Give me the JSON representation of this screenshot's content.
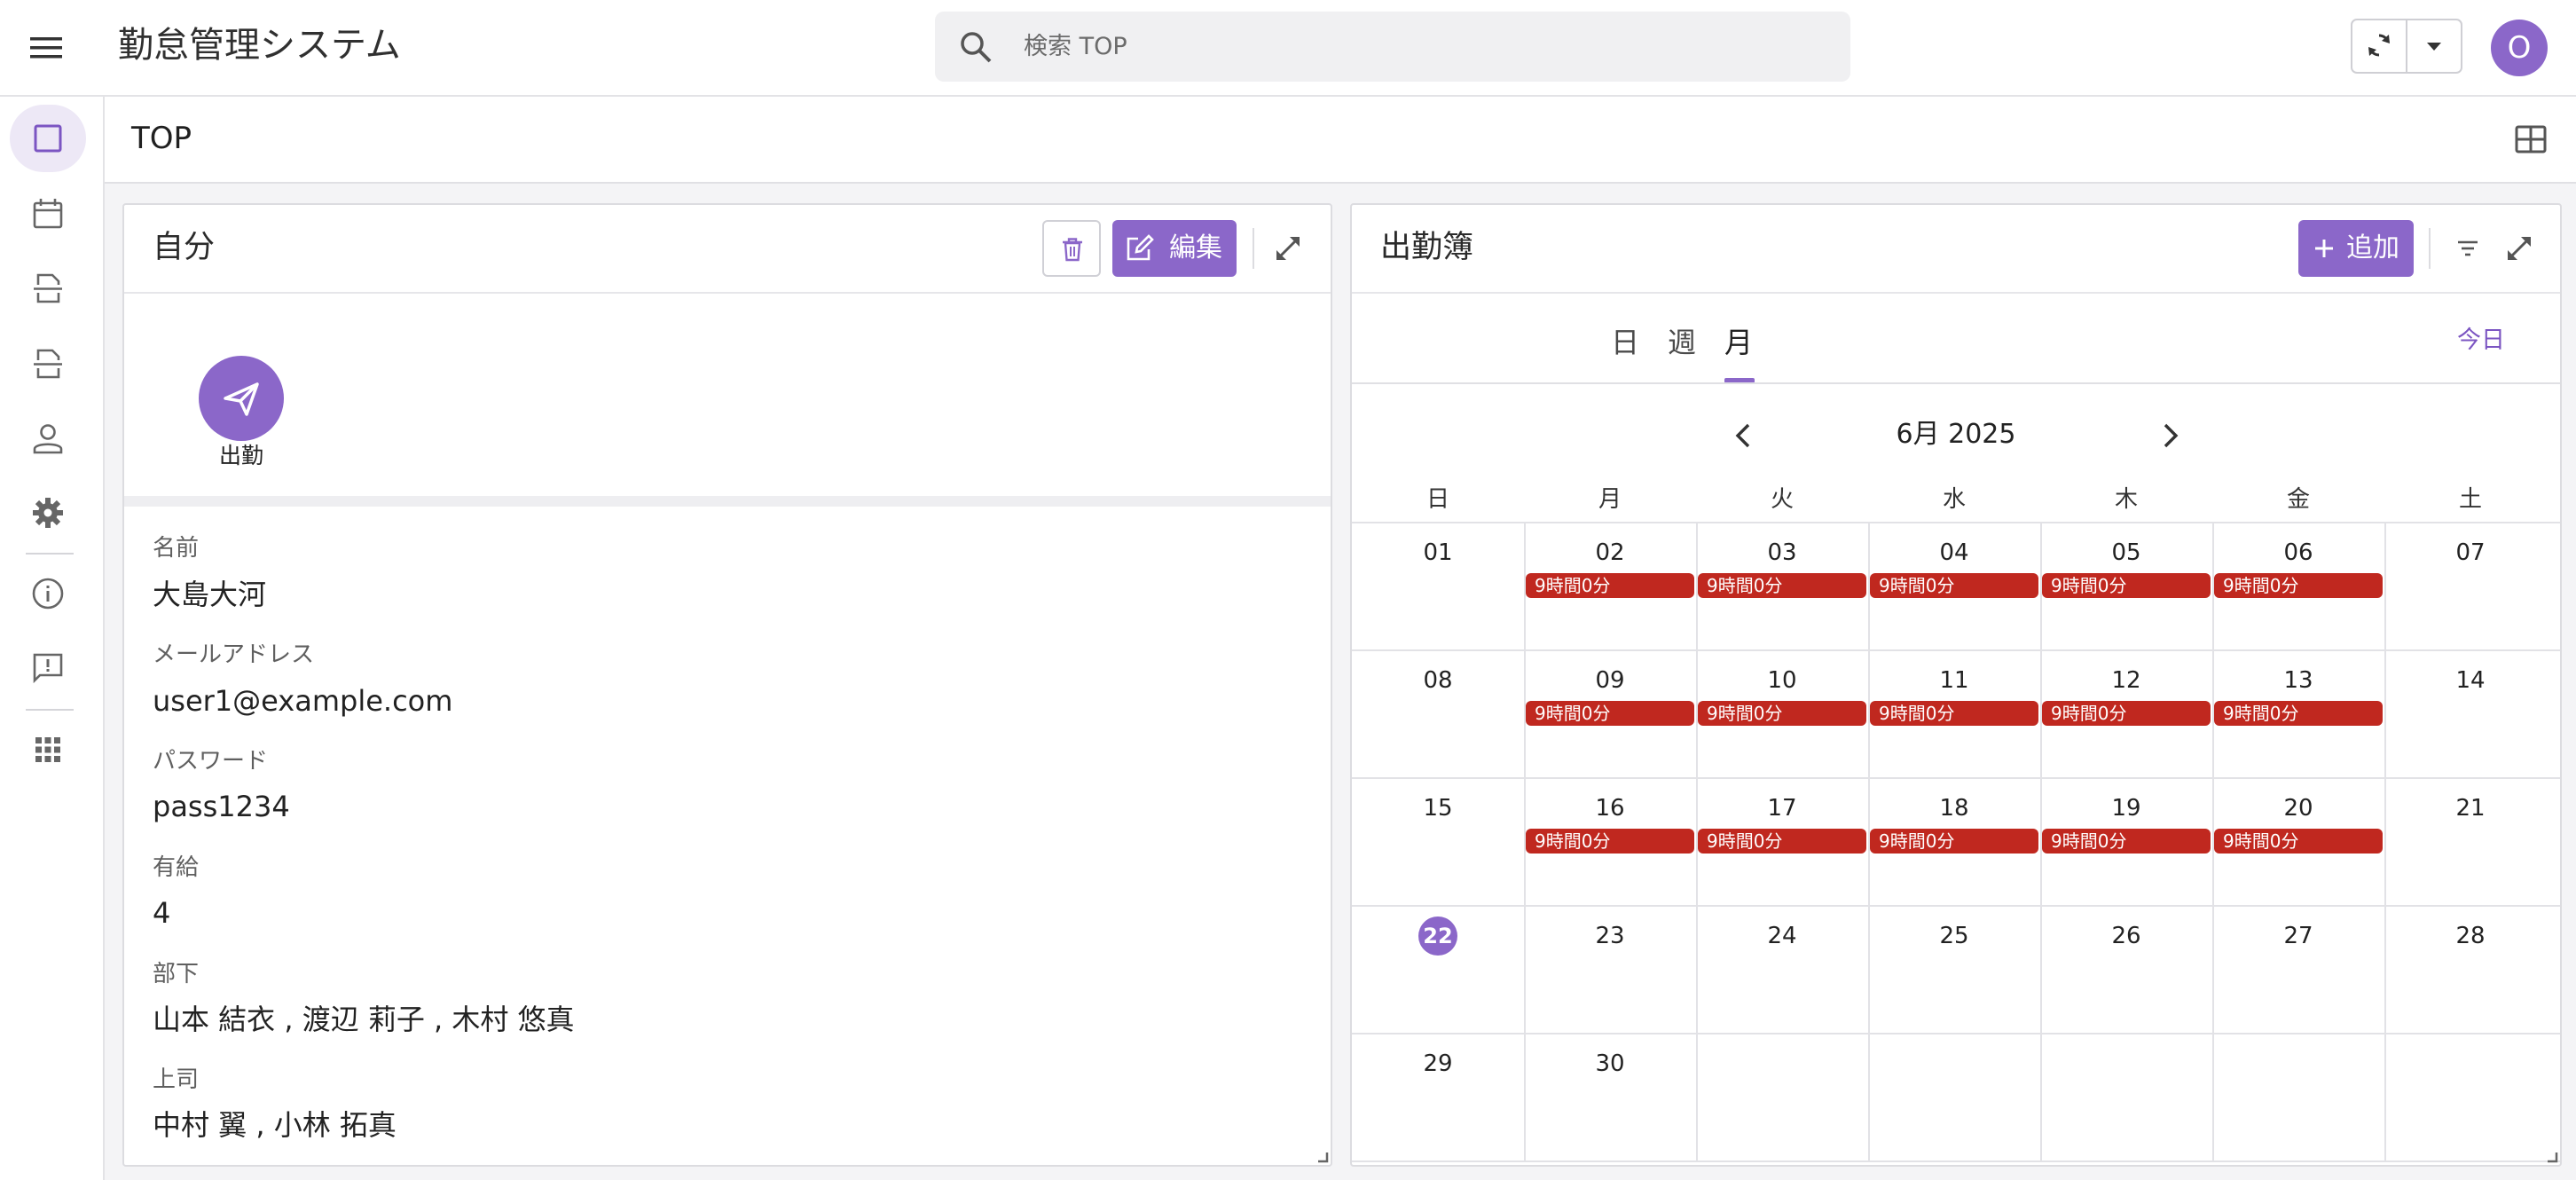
{
  "app": {
    "title": "勤怠管理システム",
    "avatar_initial": "O"
  },
  "search": {
    "placeholder": "検索 TOP"
  },
  "page": {
    "title": "TOP"
  },
  "rail": {
    "items": [
      "top",
      "calendar",
      "upload",
      "download",
      "user",
      "settings",
      "info",
      "feedback",
      "apps"
    ]
  },
  "profile": {
    "title": "自分",
    "edit_label": "編集",
    "clockin_label": "出勤",
    "fields": [
      {
        "label": "名前",
        "value": "大島大河"
      },
      {
        "label": "メールアドレス",
        "value": "user1@example.com"
      },
      {
        "label": "パスワード",
        "value": "pass1234"
      },
      {
        "label": "有給",
        "value": "4"
      },
      {
        "label": "部下",
        "value": "山本 結衣 , 渡辺 莉子 , 木村 悠真"
      },
      {
        "label": "上司",
        "value": "中村 翼 , 小林 拓真"
      }
    ]
  },
  "attendance": {
    "title": "出勤簿",
    "add_label": "追加",
    "tabs": [
      "日",
      "週",
      "月"
    ],
    "active_tab": "月",
    "today_label": "今日",
    "month_label": "6月 2025",
    "weekdays": [
      "日",
      "月",
      "火",
      "水",
      "木",
      "金",
      "土"
    ],
    "today": "22",
    "weeks": [
      [
        "01",
        "02",
        "03",
        "04",
        "05",
        "06",
        "07"
      ],
      [
        "08",
        "09",
        "10",
        "11",
        "12",
        "13",
        "14"
      ],
      [
        "15",
        "16",
        "17",
        "18",
        "19",
        "20",
        "21"
      ],
      [
        "22",
        "23",
        "24",
        "25",
        "26",
        "27",
        "28"
      ],
      [
        "29",
        "30",
        "",
        "",
        "",
        "",
        ""
      ]
    ],
    "event_label": "9時間0分",
    "event_days": [
      "02",
      "03",
      "04",
      "05",
      "06",
      "09",
      "10",
      "11",
      "12",
      "13",
      "16",
      "17",
      "18",
      "19",
      "20"
    ]
  },
  "colors": {
    "accent": "#8b67c9",
    "event": "#c0281f",
    "today_tab": "#7b55c2"
  },
  "icons": {
    "menu": "menu-icon",
    "search": "search-icon",
    "sync": "sync-icon",
    "dropdown": "caret-down-icon",
    "grid": "grid-layout-icon",
    "trash": "trash-icon",
    "edit": "edit-icon",
    "expand": "expand-icon",
    "send": "send-icon",
    "add": "plus-icon",
    "filter": "filter-icon",
    "prev": "chevron-left-icon",
    "next": "chevron-right-icon"
  }
}
